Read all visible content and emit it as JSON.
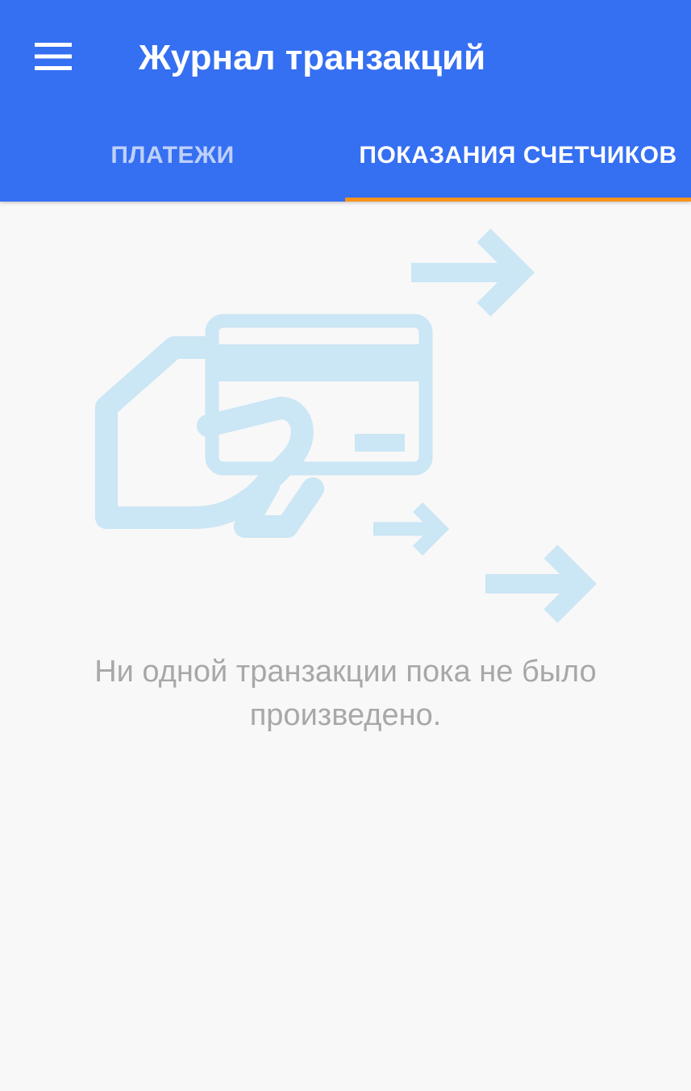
{
  "header": {
    "title": "Журнал транзакций",
    "menu_icon": "hamburger-menu-icon",
    "background_color": "#356ff2"
  },
  "tabs": [
    {
      "label": "ПЛАТЕЖИ",
      "active": false
    },
    {
      "label": "ПОКАЗАНИЯ СЧЕТЧИКОВ",
      "active": true
    }
  ],
  "tab_indicator_color": "#f7931e",
  "empty_state": {
    "icon": "hand-card-payment-icon",
    "illustration_color": "#cbe6f4",
    "message": "Ни одной транзакции пока не было произведено."
  }
}
